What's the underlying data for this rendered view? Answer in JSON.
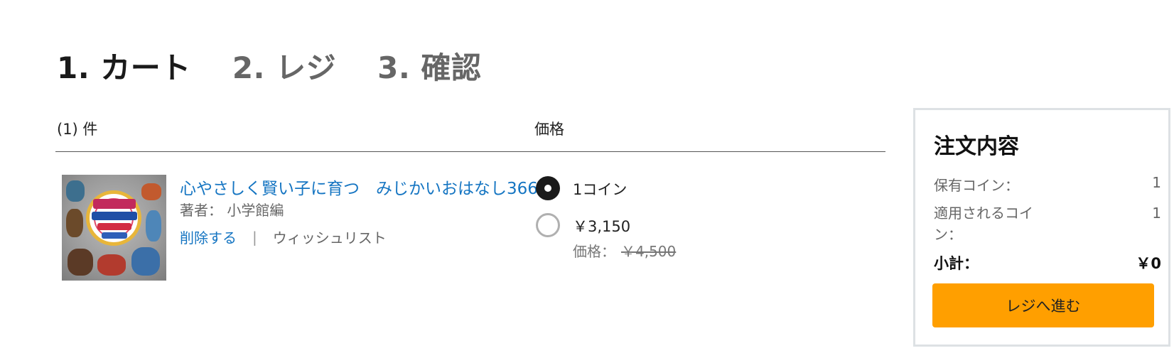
{
  "steps": {
    "cart": "1. カート",
    "register": "2. レジ",
    "confirm": "3. 確認"
  },
  "table": {
    "count_label": "(1) 件",
    "price_label": "価格"
  },
  "item": {
    "title": "心やさしく賢い子に育つ　みじかいおはなし366",
    "author": "著者：  小学館編",
    "delete_label": "削除する",
    "separator": "|",
    "wishlist_label": "ウィッシュリスト",
    "options": [
      {
        "label": "1コイン",
        "selected": true
      },
      {
        "label": "￥3,150",
        "selected": false
      }
    ],
    "original_price_label": "価格：",
    "original_price": "￥4,500"
  },
  "summary": {
    "title": "注文内容",
    "held_coins_label": "保有コイン：",
    "held_coins_value": "1",
    "applied_coins_label": "適用されるコイン：",
    "applied_coins_value": "1",
    "subtotal_label": "小計：",
    "subtotal_value": "￥0",
    "checkout_button": "レジへ進む"
  },
  "colors": {
    "link": "#1575c2",
    "button": "#ff9f00",
    "border": "#dde1e4"
  }
}
